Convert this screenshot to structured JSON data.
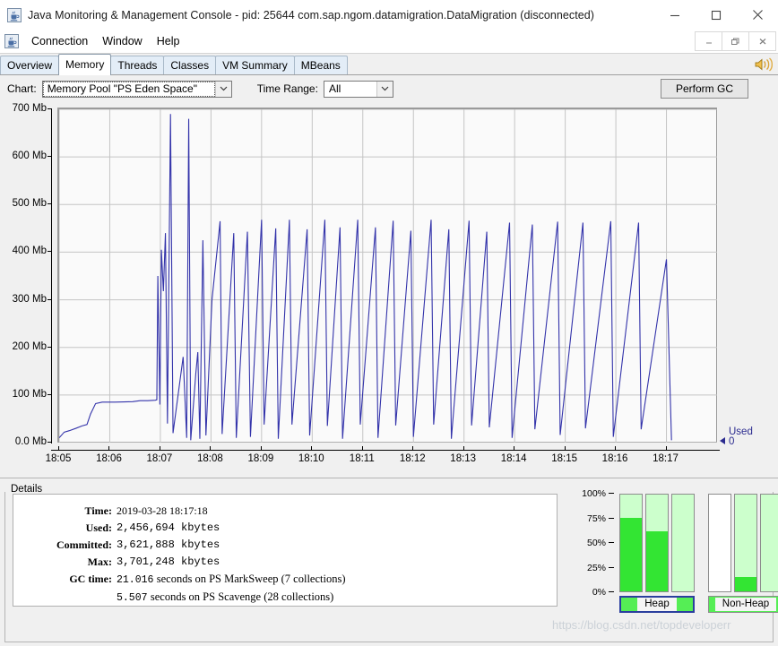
{
  "window": {
    "title": "Java Monitoring & Management Console - pid: 25644 com.sap.ngom.datamigration.DataMigration (disconnected)",
    "app_icon": "java-cup-icon",
    "minimize_label": "─",
    "maximize_label": "□",
    "close_label": "✕"
  },
  "menubar": {
    "icon": "java-cup-icon",
    "items": [
      {
        "label": "Connection"
      },
      {
        "label": "Window"
      },
      {
        "label": "Help"
      }
    ],
    "mdi_minimize": "_",
    "mdi_restore": "❐",
    "mdi_close": "✕"
  },
  "tabs": {
    "items": [
      {
        "label": "Overview",
        "selected": false
      },
      {
        "label": "Memory",
        "selected": true
      },
      {
        "label": "Threads",
        "selected": false
      },
      {
        "label": "Classes",
        "selected": false
      },
      {
        "label": "VM Summary",
        "selected": false
      },
      {
        "label": "MBeans",
        "selected": false
      }
    ],
    "right_icon": "speaker-announce-icon"
  },
  "toolbar": {
    "chart_label": "Chart:",
    "chart_value": "Memory Pool \"PS Eden Space\"",
    "time_range_label": "Time Range:",
    "time_range_value": "All",
    "perform_gc_label": "Perform GC",
    "dropdown_icon": "chevron-down-icon"
  },
  "chart_data": {
    "type": "line",
    "title": "",
    "xlabel": "",
    "ylabel": "",
    "ylim": [
      0,
      700
    ],
    "xlim": [
      0,
      13
    ],
    "grid": true,
    "line_color": "#3333aa",
    "y_ticks": [
      "0.0 Mb",
      "100 Mb",
      "200 Mb",
      "300 Mb",
      "400 Mb",
      "500 Mb",
      "600 Mb",
      "700 Mb"
    ],
    "y_tick_values": [
      0,
      100,
      200,
      300,
      400,
      500,
      600,
      700
    ],
    "x_ticks": [
      "18:05",
      "18:06",
      "18:07",
      "18:08",
      "18:09",
      "18:10",
      "18:11",
      "18:12",
      "18:13",
      "18:14",
      "18:15",
      "18:16",
      "18:17"
    ],
    "legend": {
      "name": "Used",
      "value": "0",
      "position": "right"
    },
    "series": [
      {
        "name": "Used",
        "points": [
          [
            0.0,
            10
          ],
          [
            0.1,
            22
          ],
          [
            0.2,
            25
          ],
          [
            0.33,
            30
          ],
          [
            0.45,
            35
          ],
          [
            0.55,
            38
          ],
          [
            0.62,
            60
          ],
          [
            0.72,
            82
          ],
          [
            0.85,
            85
          ],
          [
            1.1,
            85
          ],
          [
            1.45,
            86
          ],
          [
            1.6,
            88
          ],
          [
            1.75,
            88
          ],
          [
            1.9,
            89
          ],
          [
            1.93,
            90
          ],
          [
            1.95,
            350
          ],
          [
            1.99,
            80
          ],
          [
            2.02,
            405
          ],
          [
            2.06,
            318
          ],
          [
            2.1,
            440
          ],
          [
            2.14,
            40
          ],
          [
            2.2,
            690
          ],
          [
            2.25,
            20
          ],
          [
            2.45,
            180
          ],
          [
            2.52,
            10
          ],
          [
            2.56,
            680
          ],
          [
            2.6,
            5
          ],
          [
            2.7,
            145
          ],
          [
            2.74,
            190
          ],
          [
            2.78,
            8
          ],
          [
            2.84,
            425
          ],
          [
            2.9,
            15
          ],
          [
            3.02,
            300
          ],
          [
            3.18,
            465
          ],
          [
            3.22,
            18
          ],
          [
            3.45,
            440
          ],
          [
            3.5,
            10
          ],
          [
            3.72,
            443
          ],
          [
            3.78,
            12
          ],
          [
            4.0,
            468
          ],
          [
            4.05,
            38
          ],
          [
            4.28,
            450
          ],
          [
            4.33,
            8
          ],
          [
            4.55,
            468
          ],
          [
            4.6,
            38
          ],
          [
            4.9,
            448
          ],
          [
            4.95,
            15
          ],
          [
            5.25,
            468
          ],
          [
            5.3,
            35
          ],
          [
            5.55,
            452
          ],
          [
            5.6,
            8
          ],
          [
            5.9,
            468
          ],
          [
            5.95,
            38
          ],
          [
            6.25,
            452
          ],
          [
            6.3,
            10
          ],
          [
            6.6,
            466
          ],
          [
            6.65,
            36
          ],
          [
            6.95,
            445
          ],
          [
            7.0,
            12
          ],
          [
            7.35,
            468
          ],
          [
            7.4,
            38
          ],
          [
            7.7,
            448
          ],
          [
            7.75,
            8
          ],
          [
            8.1,
            466
          ],
          [
            8.15,
            36
          ],
          [
            8.45,
            443
          ],
          [
            8.5,
            32
          ],
          [
            8.9,
            462
          ],
          [
            8.95,
            10
          ],
          [
            9.35,
            458
          ],
          [
            9.4,
            28
          ],
          [
            9.85,
            464
          ],
          [
            9.9,
            16
          ],
          [
            10.35,
            462
          ],
          [
            10.4,
            30
          ],
          [
            10.9,
            465
          ],
          [
            10.95,
            12
          ],
          [
            11.45,
            462
          ],
          [
            11.5,
            28
          ],
          [
            12.0,
            385
          ],
          [
            12.1,
            5
          ]
        ]
      }
    ]
  },
  "details": {
    "legend_label": "Details",
    "rows": [
      {
        "key": "Time:",
        "value": "2019-03-28 18:17:18",
        "mono": false
      },
      {
        "key": "Used:",
        "value": "2,456,694 kbytes",
        "mono": true
      },
      {
        "key": "Committed:",
        "value": "3,621,888 kbytes",
        "mono": true
      },
      {
        "key": "Max:",
        "value": "3,701,248 kbytes",
        "mono": true
      },
      {
        "key": "GC time:",
        "value": "21.016",
        "suffix": "seconds on PS MarkSweep (7 collections)",
        "mono": true
      },
      {
        "key": "",
        "value": "5.507",
        "suffix": "seconds on PS Scavenge (28 collections)",
        "mono": true
      }
    ]
  },
  "memory_bars": {
    "axis_labels": [
      "100%",
      "75%",
      "50%",
      "25%",
      "0%"
    ],
    "axis_values": [
      100,
      75,
      50,
      25,
      0
    ],
    "groups": [
      {
        "label": "Heap",
        "selected": true,
        "bars": [
          {
            "light_pct": 100,
            "dark_pct": 76
          },
          {
            "light_pct": 100,
            "dark_pct": 62
          },
          {
            "light_pct": 100,
            "dark_pct": 0
          }
        ]
      },
      {
        "label": "Non-Heap",
        "selected": false,
        "bars": [
          {
            "light_pct": 0,
            "dark_pct": 0
          },
          {
            "light_pct": 100,
            "dark_pct": 15
          },
          {
            "light_pct": 100,
            "dark_pct": 0
          }
        ]
      }
    ]
  },
  "watermark": {
    "text": "https://blog.csdn.net/topdeveloperr"
  }
}
